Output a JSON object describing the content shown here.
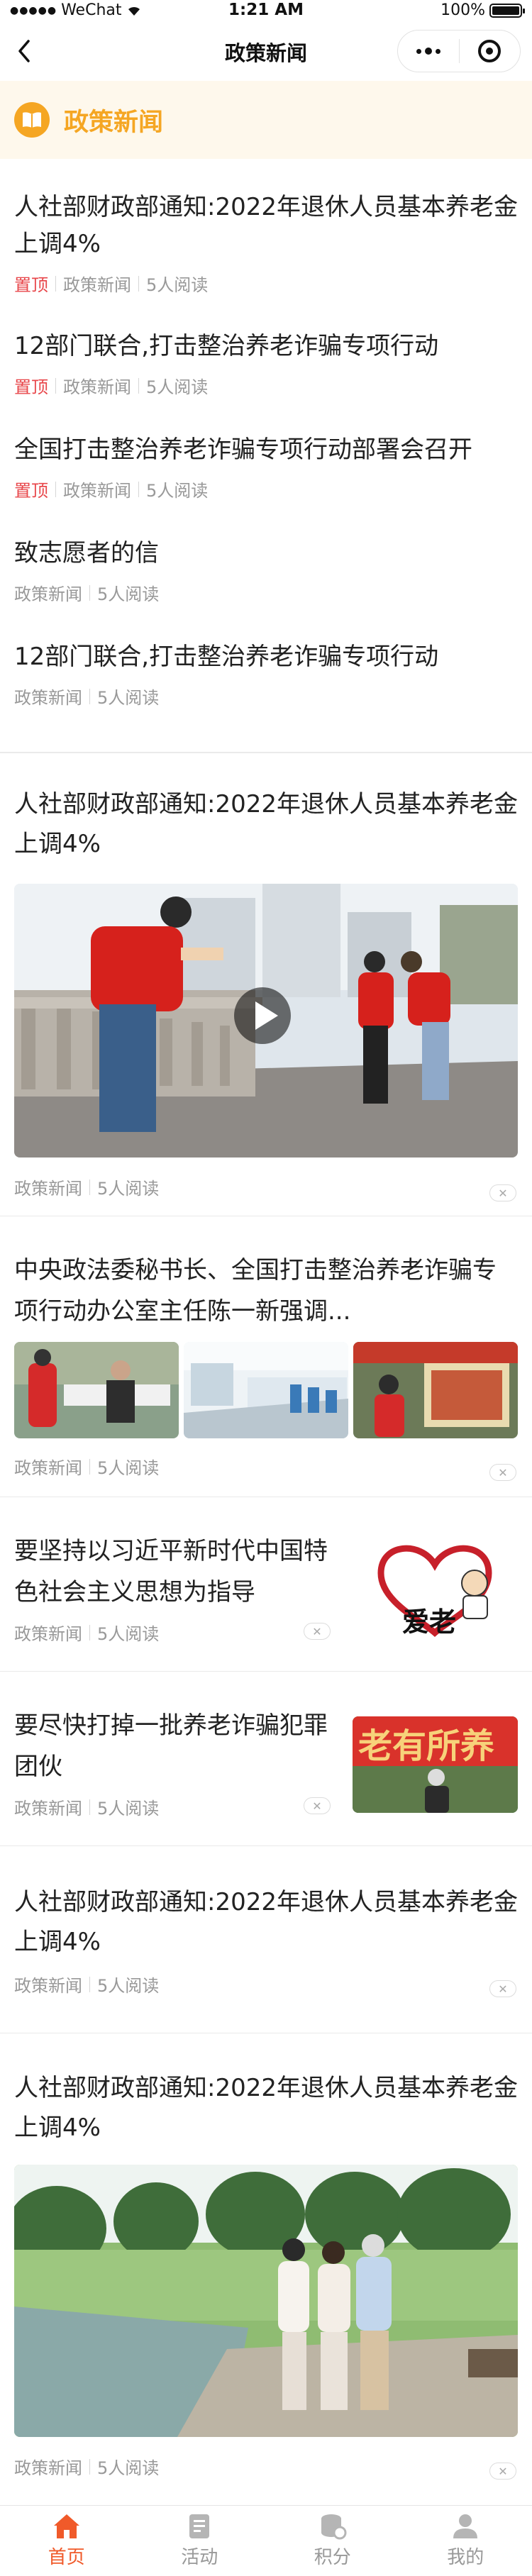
{
  "status_bar": {
    "carrier": "WeChat",
    "time": "1:21 AM",
    "battery": "100%"
  },
  "nav": {
    "title": "政策新闻"
  },
  "section": {
    "title": "政策新闻"
  },
  "top_list": [
    {
      "title": "人社部财政部通知:2022年退休人员基本养老金上调4%",
      "pinned": "置顶",
      "category": "政策新闻",
      "reads": "5人阅读"
    },
    {
      "title": "12部门联合,打击整治养老诈骗专项行动",
      "pinned": "置顶",
      "category": "政策新闻",
      "reads": "5人阅读"
    },
    {
      "title": "全国打击整治养老诈骗专项行动部署会召开",
      "pinned": "置顶",
      "category": "政策新闻",
      "reads": "5人阅读"
    },
    {
      "title": "致志愿者的信",
      "pinned": "",
      "category": "政策新闻",
      "reads": "5人阅读"
    },
    {
      "title": "12部门联合,打击整治养老诈骗专项行动",
      "pinned": "",
      "category": "政策新闻",
      "reads": "5人阅读"
    }
  ],
  "articles": {
    "video": {
      "title": "人社部财政部通知:2022年退休人员基本养老金上调4%",
      "category": "政策新闻",
      "reads": "5人阅读"
    },
    "three_images": {
      "title": "中央政法委秘书长、全国打击整治养老诈骗专项行动办公室主任陈一新强调...",
      "category": "政策新闻",
      "reads": "5人阅读"
    },
    "thumb1": {
      "title": "要坚持以习近平新时代中国特色社会主义思想为指导",
      "category": "政策新闻",
      "reads": "5人阅读",
      "image_text": "爱老"
    },
    "thumb2": {
      "title": "要尽快打掉一批养老诈骗犯罪团伙",
      "category": "政策新闻",
      "reads": "5人阅读",
      "image_text": "老有所养"
    },
    "text_only": {
      "title": "人社部财政部通知:2022年退休人员基本养老金上调4%",
      "category": "政策新闻",
      "reads": "5人阅读"
    },
    "big_image": {
      "title": "人社部财政部通知:2022年退休人员基本养老金上调4%",
      "category": "政策新闻",
      "reads": "5人阅读"
    }
  },
  "tabs": [
    {
      "label": "首页",
      "icon": "home-icon",
      "active": true
    },
    {
      "label": "活动",
      "icon": "activity-icon",
      "active": false
    },
    {
      "label": "积分",
      "icon": "points-icon",
      "active": false
    },
    {
      "label": "我的",
      "icon": "profile-icon",
      "active": false
    }
  ],
  "colors": {
    "accent": "#f5a623",
    "pinned": "#e8474b",
    "tab_active": "#f05a2a"
  }
}
